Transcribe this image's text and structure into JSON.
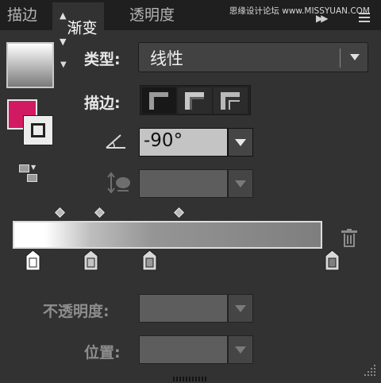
{
  "tabs": {
    "stroke_label": "描边",
    "gradient_label": "渐变",
    "gradient_arrows": "◇",
    "transparency_label": "透明度"
  },
  "watermark": "思缘设计论坛 www.MISSYUAN.COM",
  "labels": {
    "type": "类型:",
    "stroke": "描边:",
    "opacity": "不透明度:",
    "location": "位置:"
  },
  "type_select": {
    "value": "线性"
  },
  "angle": {
    "value": "-90°"
  },
  "gradient": {
    "midpoints_percent": [
      15,
      28,
      54
    ],
    "stops": [
      {
        "location_percent": 0,
        "color": "#ffffff",
        "selected": true
      },
      {
        "location_percent": 19,
        "color": "#c4c4c4",
        "selected": false
      },
      {
        "location_percent": 38,
        "color": "#9a9a9a",
        "selected": false
      },
      {
        "location_percent": 100,
        "color": "#7f7f7f",
        "selected": false
      }
    ]
  },
  "colors": {
    "fill": "#d21a63",
    "stroke": "#ececec",
    "panel_bg": "#323232",
    "tab_bg": "#1f1f1f"
  },
  "icons": {
    "collapse": "double-right-arrow-icon",
    "menu": "panel-menu-icon",
    "reverse": "reverse-gradient-icon",
    "angle": "angle-icon",
    "aspect": "aspect-ratio-icon",
    "delete": "trash-icon"
  }
}
